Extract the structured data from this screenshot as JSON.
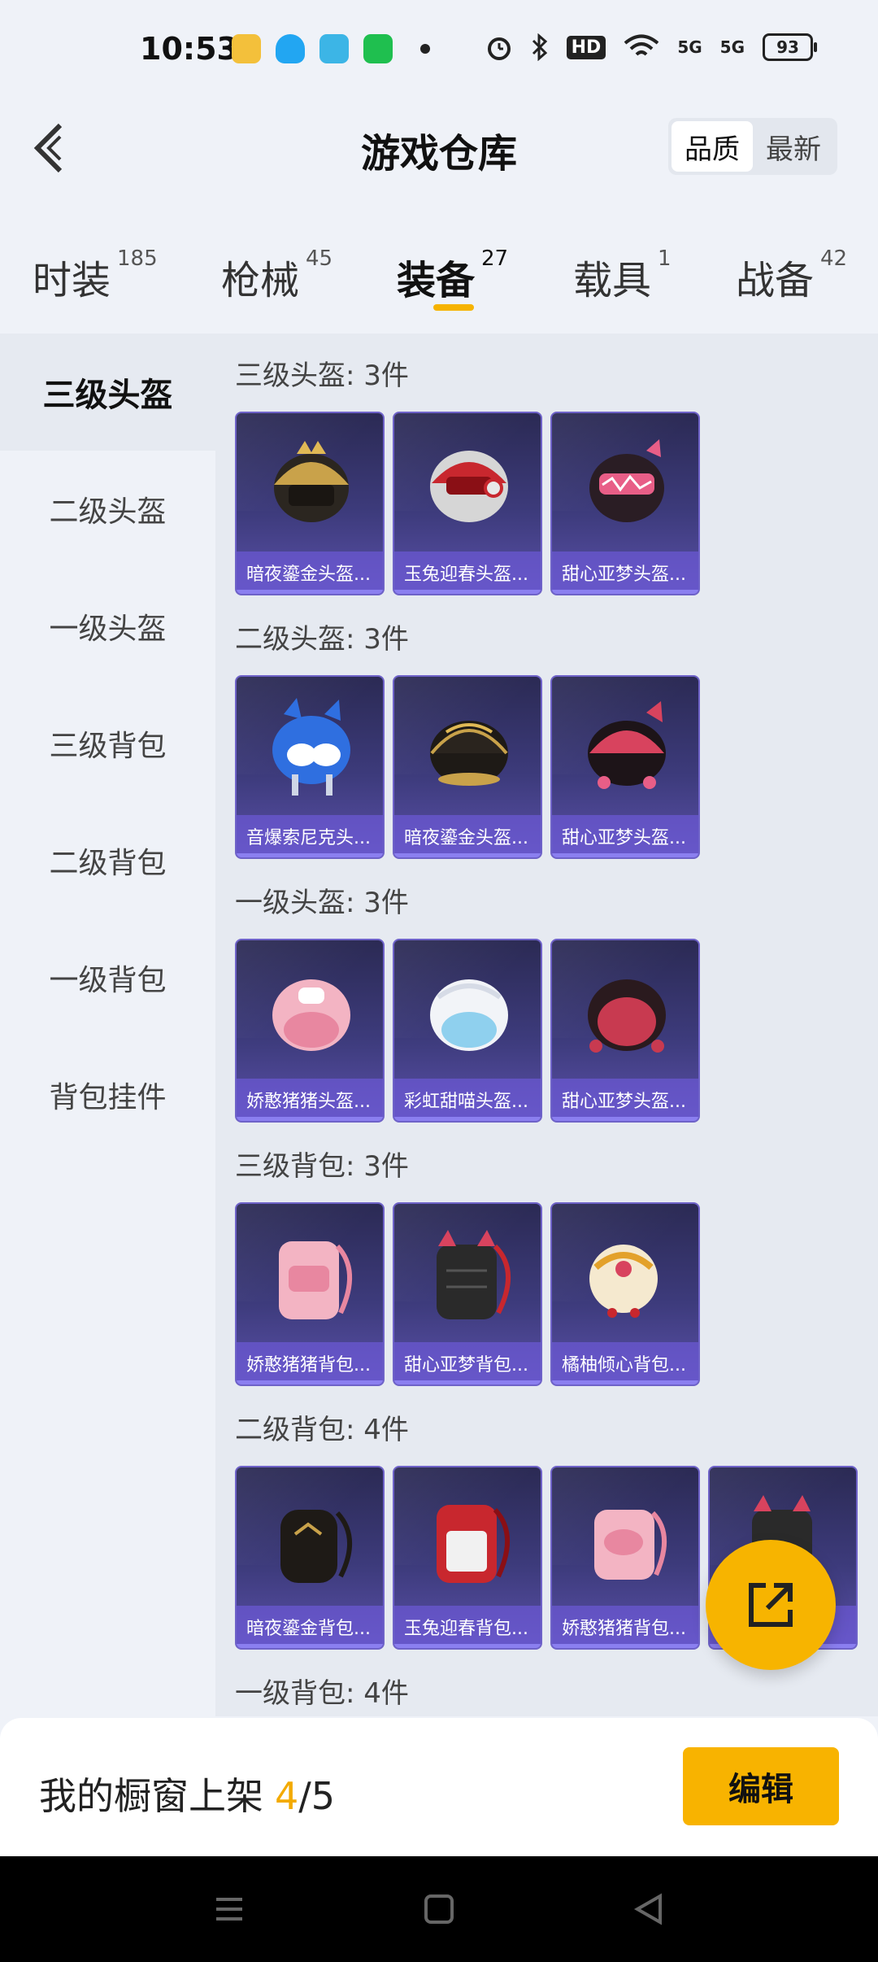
{
  "status_bar": {
    "time": "10:53",
    "hd_label": "HD",
    "net1": "5G",
    "net2": "5G",
    "battery": "93"
  },
  "header": {
    "title": "游戏仓库",
    "sort_options": [
      "品质",
      "最新"
    ],
    "sort_active": "品质"
  },
  "category_tabs": [
    {
      "label": "时装",
      "count": "185"
    },
    {
      "label": "枪械",
      "count": "45"
    },
    {
      "label": "装备",
      "count": "27",
      "active": true
    },
    {
      "label": "载具",
      "count": "1"
    },
    {
      "label": "战备",
      "count": "42"
    }
  ],
  "sidebar": {
    "items": [
      "三级头盔",
      "二级头盔",
      "一级头盔",
      "三级背包",
      "二级背包",
      "一级背包",
      "背包挂件"
    ],
    "active": "三级头盔"
  },
  "sections": [
    {
      "title": "三级头盔: 3件",
      "items": [
        "暗夜鎏金头盔...",
        "玉兔迎春头盔...",
        "甜心亚梦头盔..."
      ]
    },
    {
      "title": "二级头盔: 3件",
      "items": [
        "音爆索尼克头...",
        "暗夜鎏金头盔...",
        "甜心亚梦头盔..."
      ]
    },
    {
      "title": "一级头盔: 3件",
      "items": [
        "娇憨猪猪头盔...",
        "彩虹甜喵头盔...",
        "甜心亚梦头盔..."
      ]
    },
    {
      "title": "三级背包: 3件",
      "items": [
        "娇憨猪猪背包...",
        "甜心亚梦背包...",
        "橘柚倾心背包..."
      ]
    },
    {
      "title": "二级背包: 4件",
      "items": [
        "暗夜鎏金背包...",
        "玉兔迎春背包...",
        "娇憨猪猪背包...",
        "..."
      ]
    },
    {
      "title": "一级背包: 4件",
      "items": []
    }
  ],
  "bottom": {
    "label": "我的橱窗上架",
    "current": "4",
    "total": "/5",
    "edit_label": "编辑"
  },
  "colors": {
    "accent": "#f7b400",
    "card_top": "#2b2a54",
    "card_bottom": "#5a50a8"
  },
  "icons": [
    "back-arrow-icon",
    "share-icon",
    "menu-icon",
    "home-icon",
    "back-icon"
  ]
}
